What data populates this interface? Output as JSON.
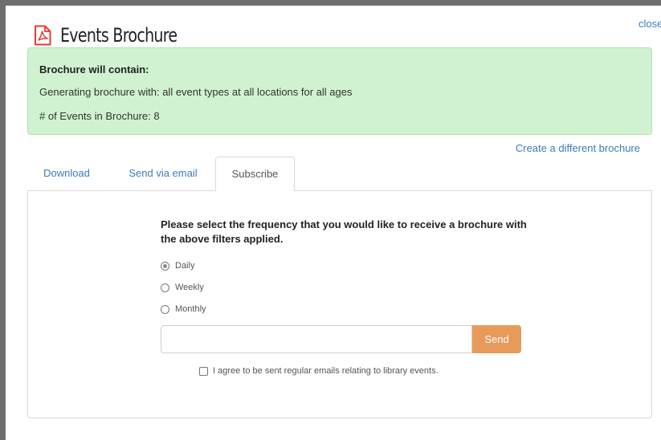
{
  "dialog": {
    "title": "Events Brochure",
    "close_label": "close"
  },
  "info": {
    "heading": "Brochure will contain:",
    "description": "Generating brochure with: all event types at all locations for all ages",
    "event_count": "# of Events in Brochure: 8"
  },
  "create_different_label": "Create a different brochure",
  "tabs": [
    {
      "label": "Download",
      "active": false
    },
    {
      "label": "Send via email",
      "active": false
    },
    {
      "label": "Subscribe",
      "active": true
    }
  ],
  "subscribe": {
    "prompt": "Please select the frequency that you would like to receive a brochure with the above filters applied.",
    "frequency_options": [
      {
        "label": "Daily",
        "selected": true
      },
      {
        "label": "Weekly",
        "selected": false
      },
      {
        "label": "Monthly",
        "selected": false
      }
    ],
    "email_value": "",
    "send_label": "Send",
    "agree_label": "I agree to be sent regular emails relating to library events.",
    "agree_checked": false
  },
  "colors": {
    "accent_link": "#3a7bbf",
    "info_background": "#d0f2d0",
    "send_button": "#e89a5a",
    "pdf_icon": "#e53935"
  },
  "icons": {
    "title_icon": "pdf-file-icon"
  }
}
